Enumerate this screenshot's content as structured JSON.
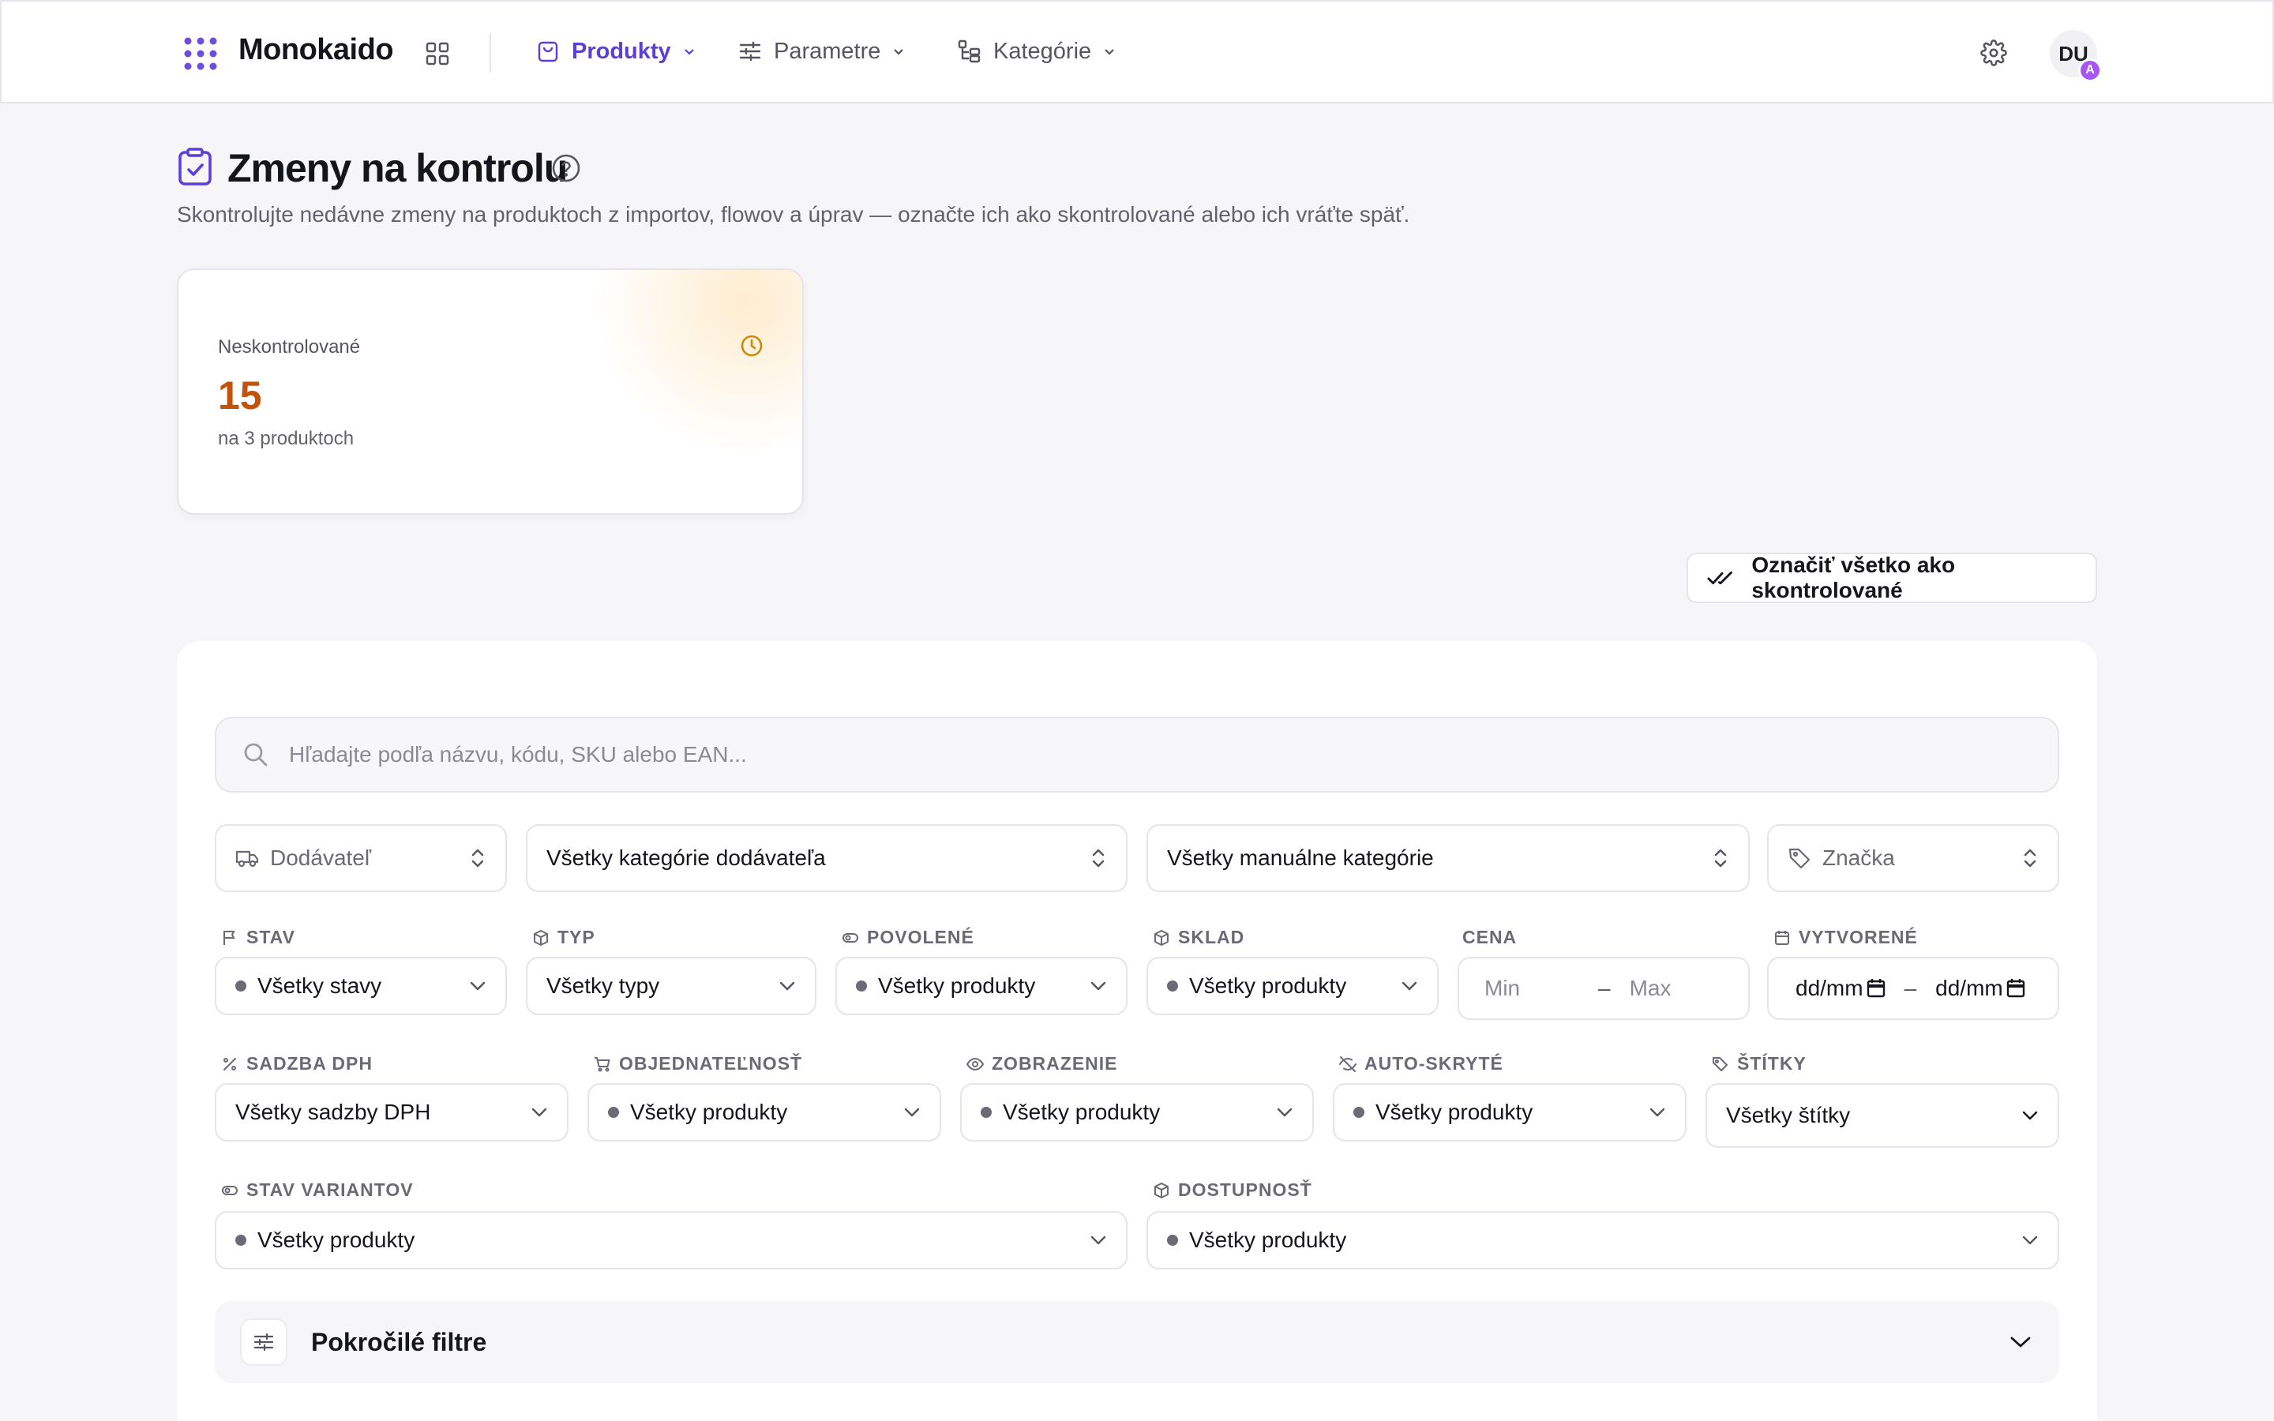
{
  "app": {
    "name": "Monokaido"
  },
  "nav": {
    "items": [
      {
        "label": "Produkty",
        "icon": "shopping-bag-icon",
        "active": true
      },
      {
        "label": "Parametre",
        "icon": "sliders-icon",
        "active": false
      },
      {
        "label": "Kategórie",
        "icon": "category-tree-icon",
        "active": false
      }
    ],
    "user_initials": "DU",
    "user_badge": "A"
  },
  "page": {
    "title": "Zmeny na kontrolu",
    "subtitle": "Skontrolujte nedávne zmeny na produktoch z importov, flowov a úprav — označte ich ako skontrolované alebo ich vráťte späť."
  },
  "stat": {
    "label": "Neskontrolované",
    "value": "15",
    "sub": "na 3 produktoch"
  },
  "actions": {
    "mark_all": "Označiť všetko ako skontrolované"
  },
  "filters": {
    "search_placeholder": "Hľadajte podľa názvu, kódu, SKU alebo EAN...",
    "supplier": "Dodávateľ",
    "supplier_categories": "Všetky kategórie dodávateľa",
    "manual_categories": "Všetky manuálne kategórie",
    "brand": "Značka",
    "stav": {
      "label": "Stav",
      "value": "Všetky stavy"
    },
    "typ": {
      "label": "Typ",
      "value": "Všetky typy"
    },
    "povolene": {
      "label": "Povolené",
      "value": "Všetky produkty"
    },
    "sklad": {
      "label": "Sklad",
      "value": "Všetky produkty"
    },
    "cena": {
      "label": "Cena",
      "min": "Min",
      "max": "Max"
    },
    "vytvorene": {
      "label": "Vytvorené",
      "from": "dd/mm",
      "to": "dd/mm"
    },
    "sadzba_dph": {
      "label": "Sadzba DPH",
      "value": "Všetky sadzby DPH"
    },
    "objednatelnost": {
      "label": "Objednateľnosť",
      "value": "Všetky produkty"
    },
    "zobrazenie": {
      "label": "Zobrazenie",
      "value": "Všetky produkty"
    },
    "auto_skryte": {
      "label": "Auto-skryté",
      "value": "Všetky produkty"
    },
    "stitky": {
      "label": "Štítky",
      "value": "Všetky štítky"
    },
    "stav_variantov": {
      "label": "Stav variantov",
      "value": "Všetky produkty"
    },
    "dostupnost": {
      "label": "Dostupnosť",
      "value": "Všetky produkty"
    },
    "advanced": "Pokročilé filtre",
    "range_dash": "–"
  },
  "colors": {
    "accent": "#5b3fd6",
    "stat_value": "#c2530a",
    "badge": "#a855f7"
  }
}
